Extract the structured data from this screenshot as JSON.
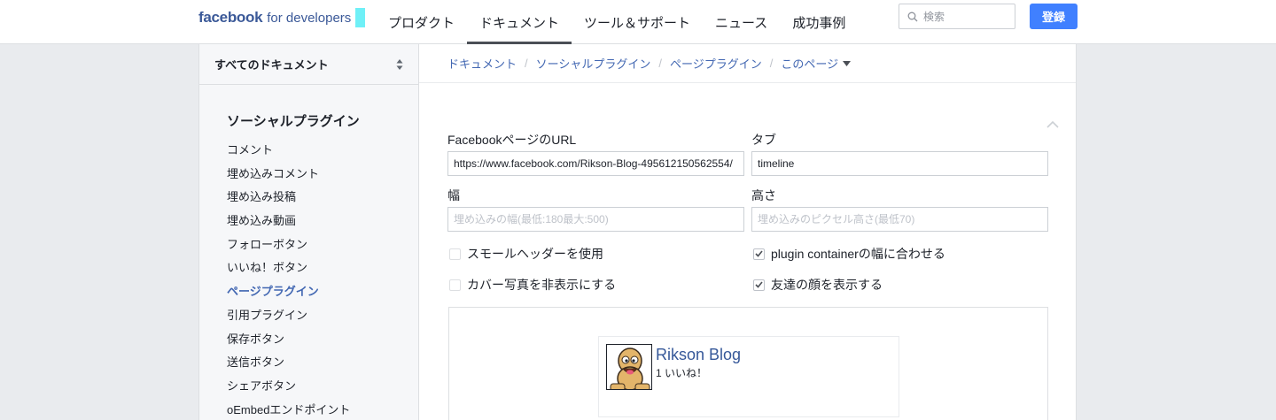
{
  "brand": {
    "name": "facebook",
    "suffix": "for developers",
    "accent_color": "#6ff0f7"
  },
  "nav": {
    "items": [
      {
        "label": "プロダクト",
        "active": false
      },
      {
        "label": "ドキュメント",
        "active": true
      },
      {
        "label": "ツール＆サポート",
        "active": false
      },
      {
        "label": "ニュース",
        "active": false
      },
      {
        "label": "成功事例",
        "active": false
      }
    ]
  },
  "search": {
    "placeholder": "検索",
    "icon": "search-icon"
  },
  "login_button": {
    "label": "登録",
    "color": "#4080ff"
  },
  "sidebar": {
    "header_label": "すべてのドキュメント",
    "section_title": "ソーシャルプラグイン",
    "items": [
      {
        "label": "コメント",
        "active": false
      },
      {
        "label": "埋め込みコメント",
        "active": false
      },
      {
        "label": "埋め込み投稿",
        "active": false
      },
      {
        "label": "埋め込み動画",
        "active": false
      },
      {
        "label": "フォローボタン",
        "active": false
      },
      {
        "label": "いいね！ボタン",
        "active": false
      },
      {
        "label": "ページプラグイン",
        "active": true
      },
      {
        "label": "引用プラグイン",
        "active": false
      },
      {
        "label": "保存ボタン",
        "active": false
      },
      {
        "label": "送信ボタン",
        "active": false
      },
      {
        "label": "シェアボタン",
        "active": false
      },
      {
        "label": "oEmbedエンドポイント",
        "active": false
      }
    ]
  },
  "breadcrumb": {
    "items": [
      "ドキュメント",
      "ソーシャルプラグイン",
      "ページプラグイン",
      "このページ"
    ],
    "separator": "/"
  },
  "form": {
    "url": {
      "label": "FacebookページのURL",
      "value": "https://www.facebook.com/Rikson-Blog-495612150562554/"
    },
    "tabs": {
      "label": "タブ",
      "value": "timeline"
    },
    "width": {
      "label": "幅",
      "placeholder": "埋め込みの幅(最低:180最大:500)"
    },
    "height": {
      "label": "高さ",
      "placeholder": "埋め込みのピクセル高さ(最低70)"
    },
    "checkboxes": [
      {
        "label": "スモールヘッダーを使用",
        "checked": false
      },
      {
        "label": "plugin containerの幅に合わせる",
        "checked": true
      },
      {
        "label": "カバー写真を非表示にする",
        "checked": false
      },
      {
        "label": "友達の顔を表示する",
        "checked": true
      }
    ]
  },
  "preview": {
    "page_name": "Rikson Blog",
    "likes": "1 いいね！"
  }
}
